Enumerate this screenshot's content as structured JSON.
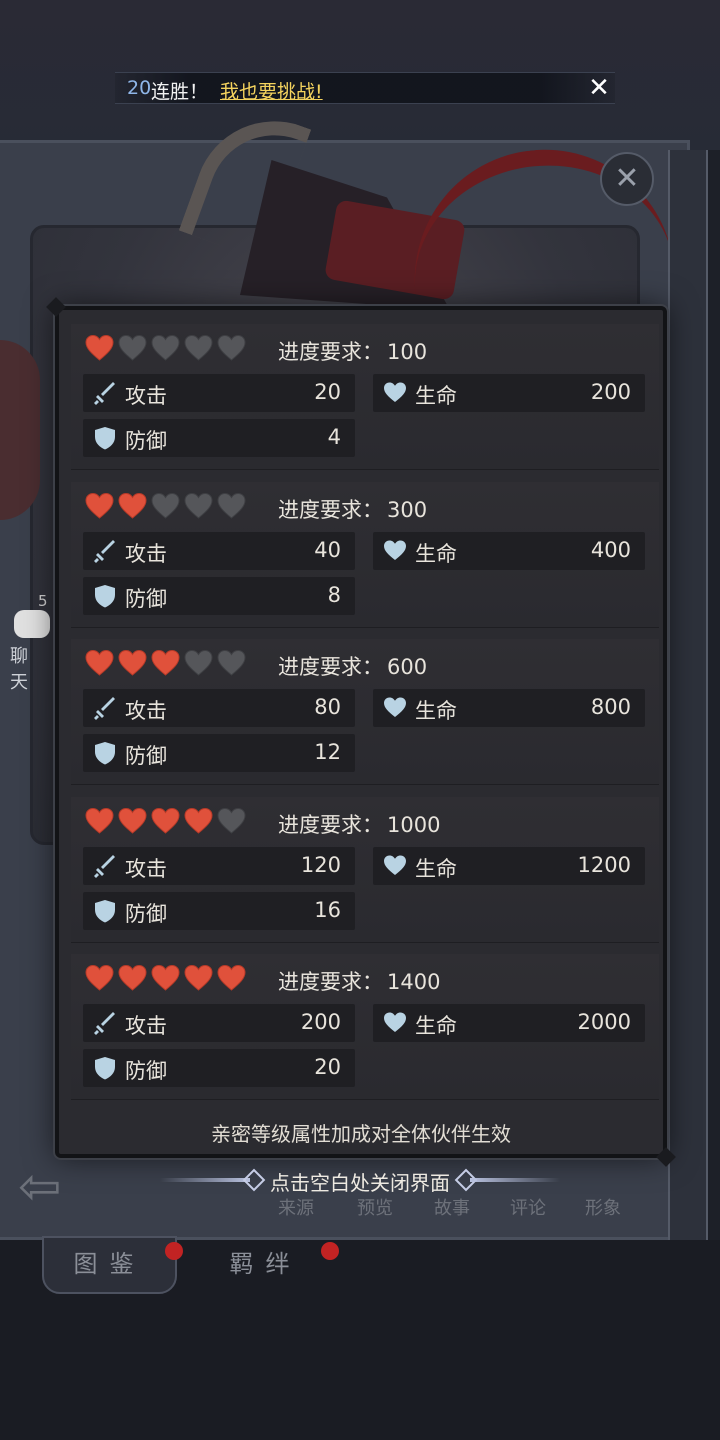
{
  "announcement": {
    "count": "20",
    "text": "连胜！",
    "link": "我也要挑战!",
    "close_icon": "close-x-icon"
  },
  "background": {
    "chat_badge": "5",
    "chat_label": "聊天",
    "tabs": [
      "图鉴",
      "羁绊"
    ],
    "menu": [
      "来源",
      "预览",
      "故事",
      "评论",
      "形象"
    ]
  },
  "modal": {
    "requirement_label": "进度要求：",
    "attack_label": "攻击",
    "health_label": "生命",
    "defense_label": "防御",
    "tiers": [
      {
        "hearts_filled": 1,
        "hearts_total": 5,
        "requirement": "100",
        "attack": "20",
        "health": "200",
        "defense": "4"
      },
      {
        "hearts_filled": 2,
        "hearts_total": 5,
        "requirement": "300",
        "attack": "40",
        "health": "400",
        "defense": "8"
      },
      {
        "hearts_filled": 3,
        "hearts_total": 5,
        "requirement": "600",
        "attack": "80",
        "health": "800",
        "defense": "12"
      },
      {
        "hearts_filled": 4,
        "hearts_total": 5,
        "requirement": "1000",
        "attack": "120",
        "health": "1200",
        "defense": "16"
      },
      {
        "hearts_filled": 5,
        "hearts_total": 5,
        "requirement": "1400",
        "attack": "200",
        "health": "2000",
        "defense": "20"
      }
    ],
    "footer_note": "亲密等级属性加成对全体伙伴生效"
  },
  "close_hint": "点击空白处关闭界面",
  "colors": {
    "heart_filled": "#e0513b",
    "heart_empty": "#55565a",
    "stat_icon": "#b9d3e3",
    "link": "#f4d35e",
    "count": "#8fb6e8"
  }
}
